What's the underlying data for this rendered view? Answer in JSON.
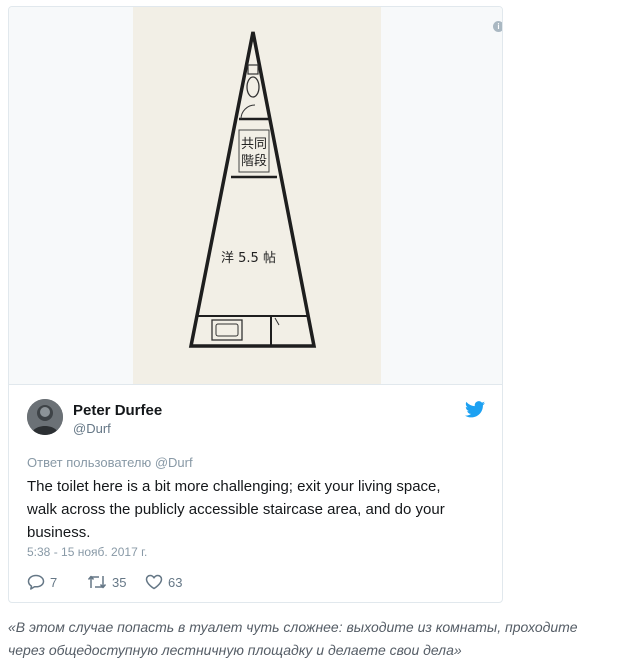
{
  "media": {
    "room_label": "洋 5.5 帖",
    "stair_label_line1": "共同",
    "stair_label_line2": "階段"
  },
  "tweet": {
    "author_name": "Peter Durfee",
    "author_handle": "@Durf",
    "reply_to": "Ответ пользователю @Durf",
    "text_line1": "The toilet here is a bit more challenging; exit your living space,",
    "text_line2": "walk across the publicly accessible staircase area, and do your",
    "text_line3": "business.",
    "timestamp": "5:38 - 15 нояб. 2017 г.",
    "replies": "7",
    "retweets": "35",
    "likes": "63"
  },
  "caption": {
    "line1": "«В этом случае попасть в туалет чуть сложнее: выходите из комнаты, проходите",
    "line2": "через общедоступную лестничную площадку и делаете свои дела»"
  },
  "colors": {
    "twitter_blue": "#1da1f2",
    "text_primary": "#14171a",
    "text_secondary": "#657786",
    "plan_background": "#f2efe6"
  },
  "icons": [
    "info-icon",
    "twitter-bird-icon",
    "reply-icon",
    "retweet-icon",
    "like-icon"
  ]
}
